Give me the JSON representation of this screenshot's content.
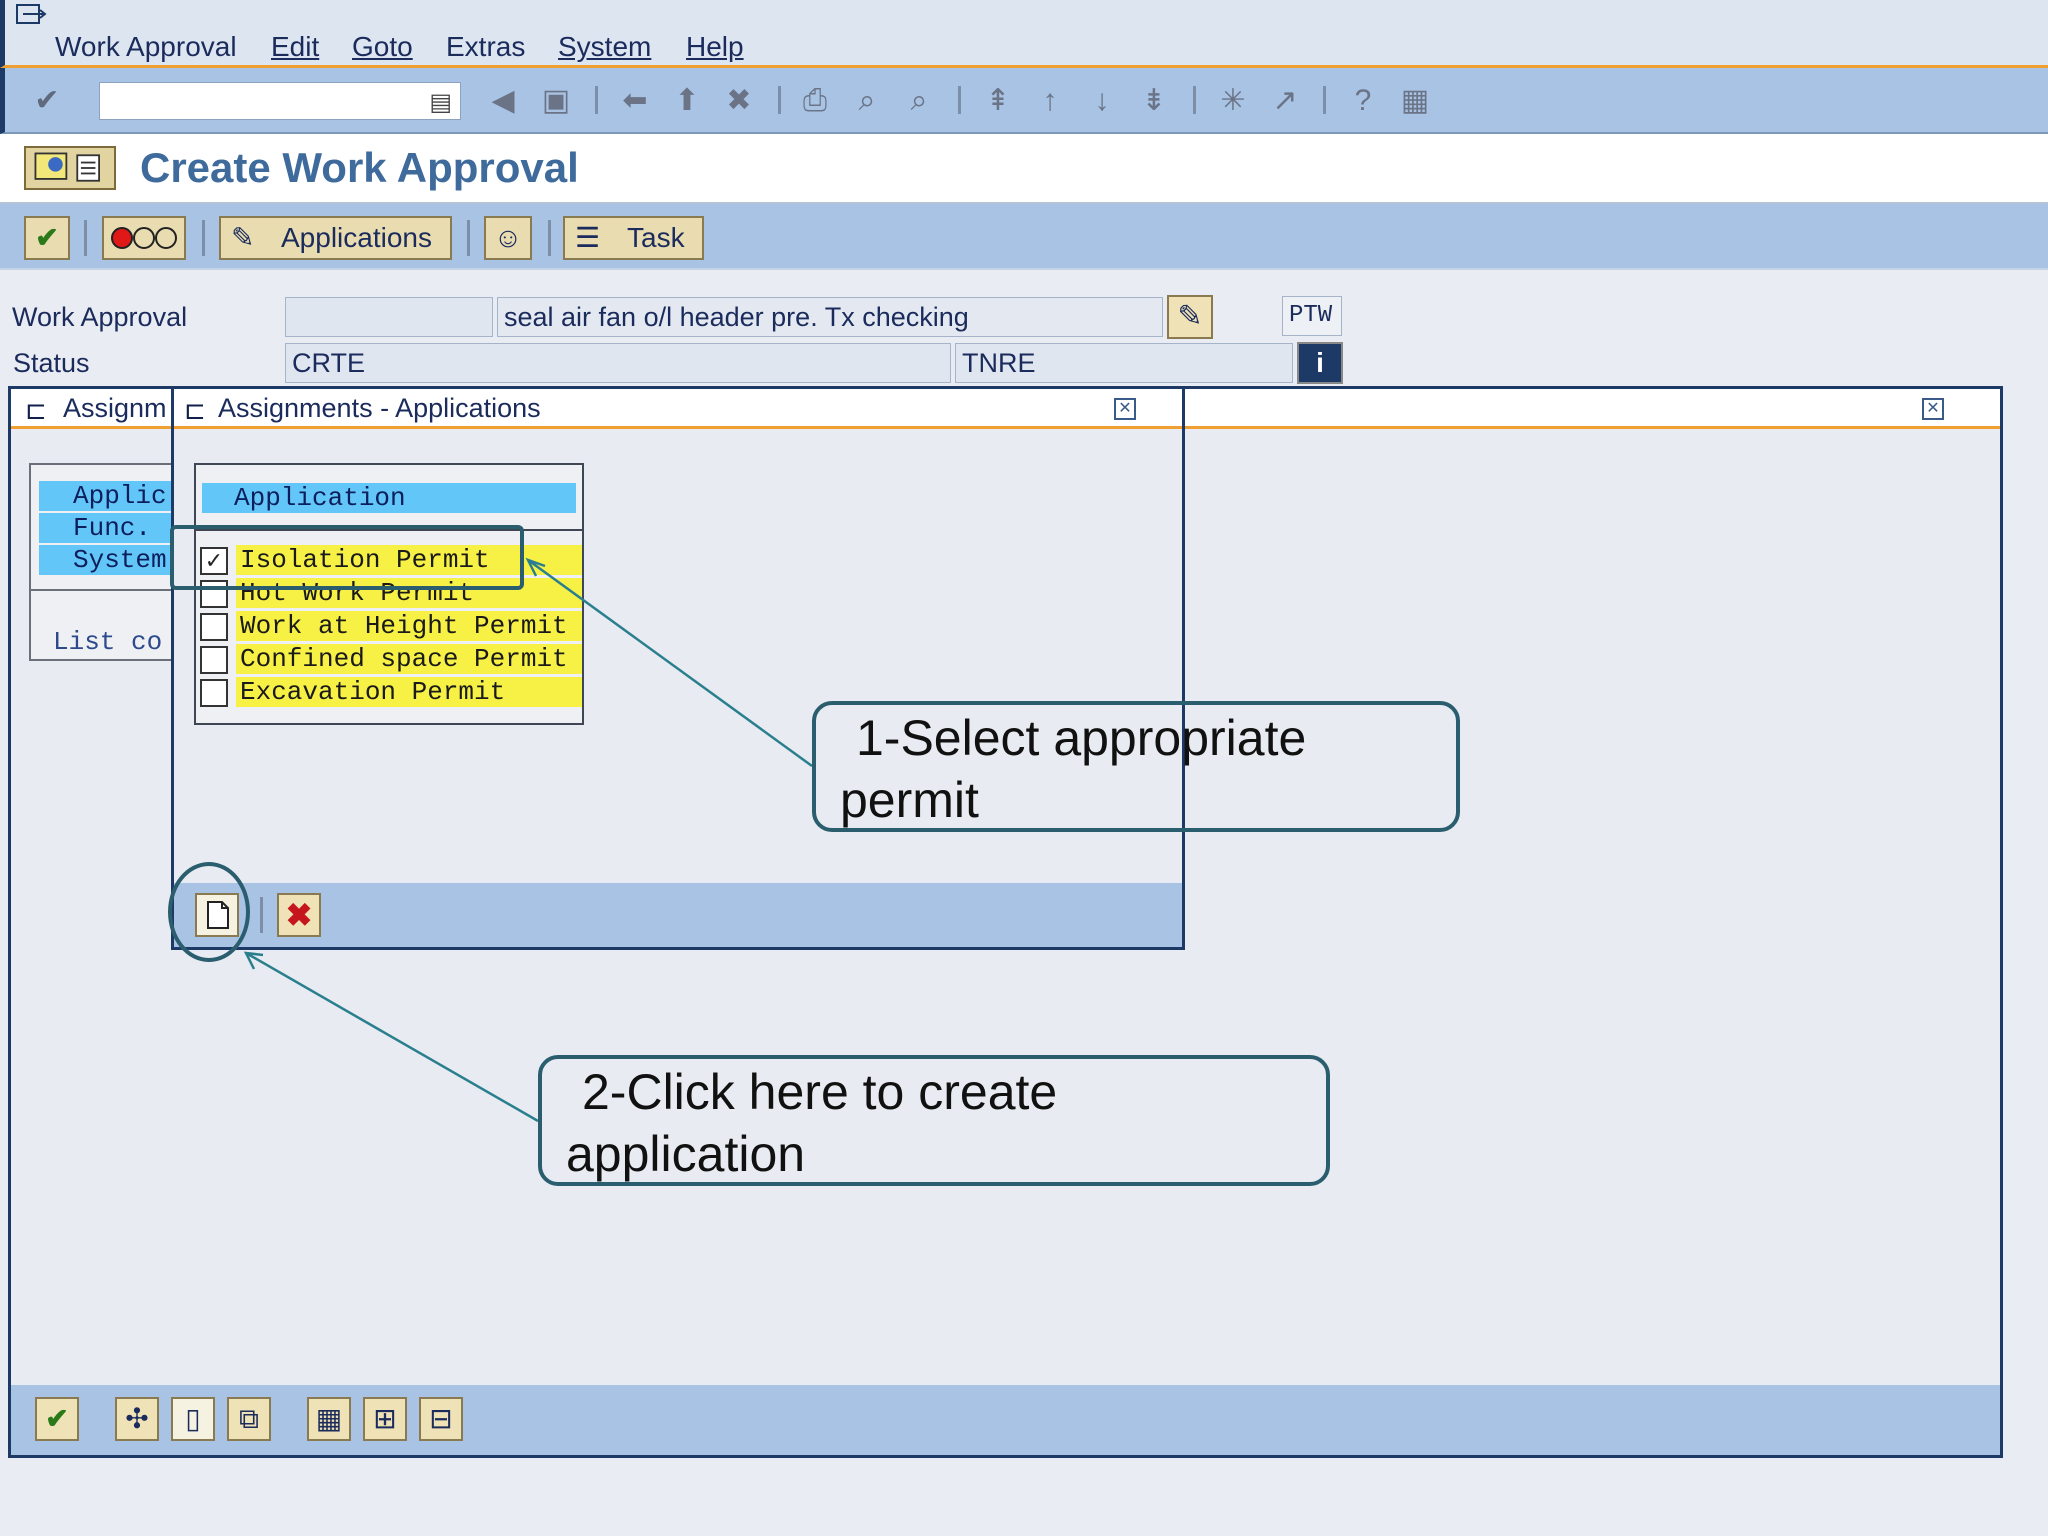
{
  "menu": {
    "items": [
      {
        "label": "Work Approval"
      },
      {
        "label": "Edit"
      },
      {
        "label": "Goto"
      },
      {
        "label": "Extras"
      },
      {
        "label": "System"
      },
      {
        "label": "Help"
      }
    ]
  },
  "toolbar": {
    "command_field_value": "",
    "icons": [
      "enter-icon",
      "back-icon",
      "save-icon",
      "back-arrow-icon",
      "exit-icon",
      "cancel-icon",
      "print-icon",
      "find-icon",
      "find-next-icon",
      "first-page-icon",
      "previous-page-icon",
      "next-page-icon",
      "last-page-icon",
      "create-session-icon",
      "shortcut-icon",
      "help-icon",
      "layout-icon"
    ]
  },
  "page": {
    "title": "Create Work Approval"
  },
  "app_toolbar": {
    "applications_label": "Applications",
    "task_label": "Task"
  },
  "header": {
    "work_approval_label": "Work Approval",
    "work_approval_number": "",
    "work_approval_description": "seal air fan o/l header pre. Tx checking",
    "ptw_label": "PTW",
    "status_label": "Status",
    "status_system": "CRTE",
    "status_user": "TNRE"
  },
  "outer_dialog": {
    "title": "Assignm",
    "rows": [
      "Applic",
      "Func.",
      "System"
    ],
    "list_text": "List co"
  },
  "inner_dialog": {
    "title": "Assignments - Applications",
    "column_header": "Application",
    "applications": [
      {
        "label": "Isolation Permit",
        "checked": true,
        "check_mark": "✓"
      },
      {
        "label": "Hot Work Permit",
        "checked": false,
        "check_mark": ""
      },
      {
        "label": "Work at Height Permit",
        "checked": false,
        "check_mark": ""
      },
      {
        "label": "Confined space Permit",
        "checked": false,
        "check_mark": ""
      },
      {
        "label": "Excavation Permit",
        "checked": false,
        "check_mark": ""
      }
    ]
  },
  "annotations": {
    "callout1_line1": "1-Select appropriate",
    "callout1_line2": "permit",
    "callout2_line1": "2-Click here to create",
    "callout2_line2": "application"
  },
  "colors": {
    "toolbar_blue": "#a9c3e5",
    "highlight_cyan": "#62c7f8",
    "row_yellow": "#f7f146",
    "orange_rule": "#f0a030",
    "annotation_teal": "#2a5d6e"
  }
}
